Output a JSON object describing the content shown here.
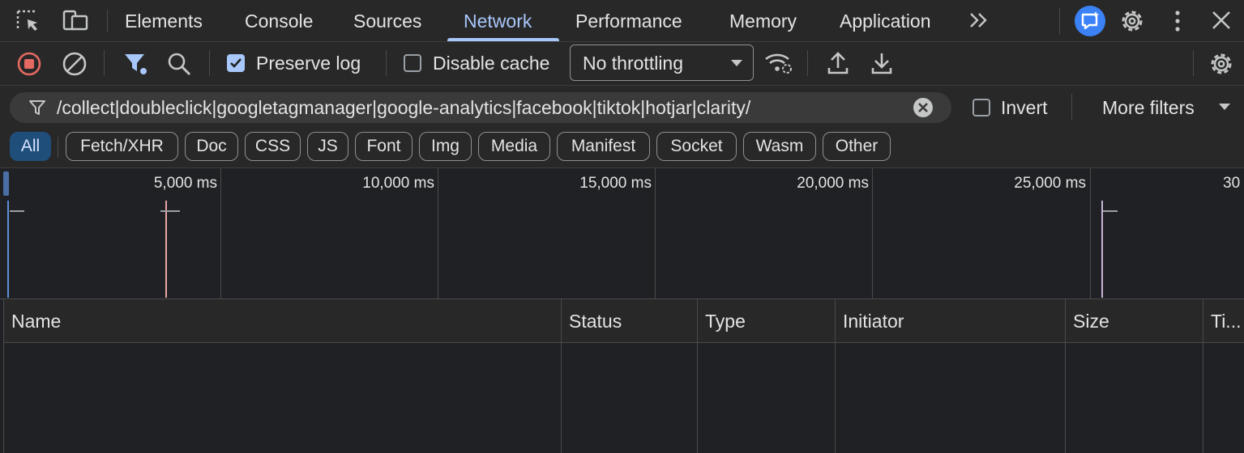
{
  "tabs": [
    {
      "label": "Elements",
      "active": false
    },
    {
      "label": "Console",
      "active": false
    },
    {
      "label": "Sources",
      "active": false
    },
    {
      "label": "Network",
      "active": true
    },
    {
      "label": "Performance",
      "active": false
    },
    {
      "label": "Memory",
      "active": false
    },
    {
      "label": "Application",
      "active": false
    }
  ],
  "toolbar": {
    "preserve_log_label": "Preserve log",
    "preserve_log_checked": true,
    "disable_cache_label": "Disable cache",
    "disable_cache_checked": false,
    "throttling_value": "No throttling"
  },
  "filter": {
    "value": "/collect|doubleclick|googletagmanager|google-analytics|facebook|tiktok|hotjar|clarity/",
    "invert_label": "Invert",
    "invert_checked": false,
    "more_filters_label": "More filters"
  },
  "type_filters": [
    {
      "label": "All",
      "active": true
    },
    {
      "label": "Fetch/XHR",
      "active": false
    },
    {
      "label": "Doc",
      "active": false
    },
    {
      "label": "CSS",
      "active": false
    },
    {
      "label": "JS",
      "active": false
    },
    {
      "label": "Font",
      "active": false
    },
    {
      "label": "Img",
      "active": false
    },
    {
      "label": "Media",
      "active": false
    },
    {
      "label": "Manifest",
      "active": false
    },
    {
      "label": "Socket",
      "active": false
    },
    {
      "label": "Wasm",
      "active": false
    },
    {
      "label": "Other",
      "active": false
    }
  ],
  "timeline": {
    "ticks": [
      "5,000 ms",
      "10,000 ms",
      "15,000 ms",
      "20,000 ms",
      "25,000 ms",
      "30"
    ]
  },
  "table": {
    "columns": [
      "Name",
      "Status",
      "Type",
      "Initiator",
      "Size",
      "Ti..."
    ]
  },
  "colors": {
    "accent": "#a8c7fa",
    "active_chip": "#1f4e7a",
    "record_stop": "#e46962",
    "ai_assist": "#3b82f6"
  }
}
